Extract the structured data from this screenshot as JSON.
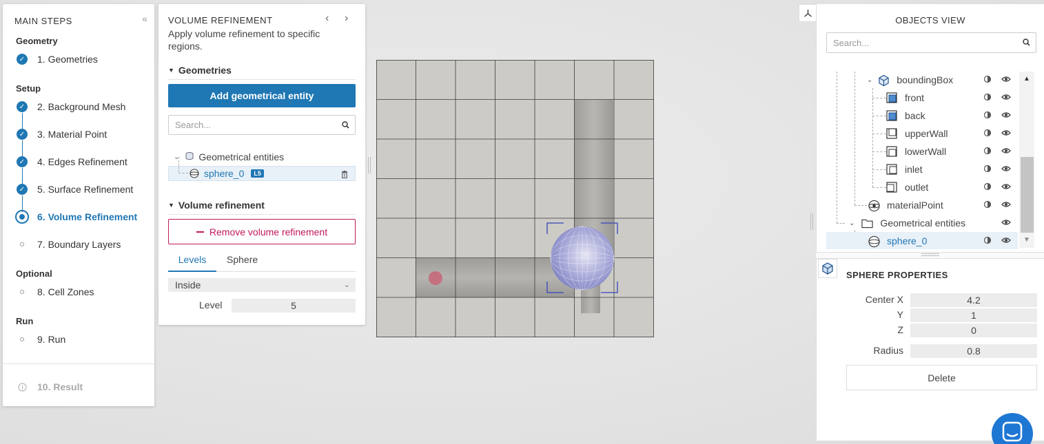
{
  "steps_panel": {
    "title": "MAIN STEPS",
    "collapse_icon": "double-chevron-left-icon",
    "sections": {
      "geometry": "Geometry",
      "setup": "Setup",
      "optional": "Optional",
      "run": "Run"
    },
    "steps": [
      {
        "label": "1. Geometries",
        "state": "done"
      },
      {
        "label": "2. Background Mesh",
        "state": "done"
      },
      {
        "label": "3. Material Point",
        "state": "done"
      },
      {
        "label": "4. Edges Refinement",
        "state": "done"
      },
      {
        "label": "5. Surface Refinement",
        "state": "done"
      },
      {
        "label": "6. Volume Refinement",
        "state": "current"
      },
      {
        "label": "7. Boundary Layers",
        "state": "pending"
      },
      {
        "label": "8. Cell Zones",
        "state": "pending"
      },
      {
        "label": "9. Run",
        "state": "pending"
      },
      {
        "label": "10. Result",
        "state": "disabled"
      }
    ]
  },
  "volume_panel": {
    "title": "VOLUME REFINEMENT",
    "description": "Apply volume refinement to specific regions.",
    "geometries_heading": "Geometries",
    "add_button": "Add geometrical entity",
    "search_placeholder": "Search...",
    "tree_root": "Geometrical entities",
    "tree_item": "sphere_0",
    "tree_item_badge": "L5",
    "volume_heading": "Volume refinement",
    "remove_button": "Remove volume refinement",
    "tabs": [
      "Levels",
      "Sphere"
    ],
    "active_tab": "Levels",
    "region_select": "Inside",
    "level_label": "Level",
    "level_value": "5"
  },
  "objects_view": {
    "title": "OBJECTS VIEW",
    "search_placeholder": "Search...",
    "tree": [
      {
        "label": "boundingBox",
        "icon": "bounding-box-icon"
      },
      {
        "label": "front",
        "icon": "patch-icon"
      },
      {
        "label": "back",
        "icon": "patch-icon"
      },
      {
        "label": "upperWall",
        "icon": "patch-icon"
      },
      {
        "label": "lowerWall",
        "icon": "patch-icon"
      },
      {
        "label": "inlet",
        "icon": "patch-icon"
      },
      {
        "label": "outlet",
        "icon": "patch-icon"
      },
      {
        "label": "materialPoint",
        "icon": "material-point-icon"
      },
      {
        "label": "Geometrical entities",
        "icon": "folder-icon"
      },
      {
        "label": "sphere_0",
        "icon": "sphere-icon"
      }
    ]
  },
  "sphere_properties": {
    "title": "SPHERE PROPERTIES",
    "center_label": "Center X",
    "y_label": "Y",
    "z_label": "Z",
    "radius_label": "Radius",
    "center_x": "4.2",
    "center_y": "1",
    "center_z": "0",
    "radius": "0.8",
    "delete_button": "Delete"
  },
  "colors": {
    "accent": "#1f77b4",
    "danger": "#c2185b",
    "selection": "#e8f0f8"
  }
}
